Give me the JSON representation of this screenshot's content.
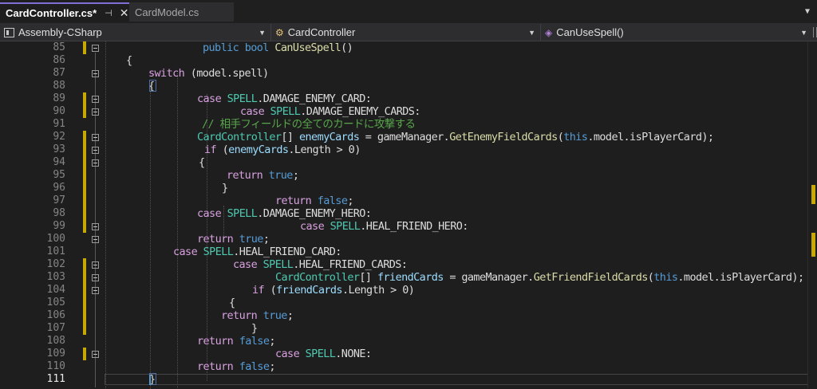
{
  "tabs": [
    {
      "label": "CardController.cs*",
      "active": true
    },
    {
      "label": "CardModel.cs",
      "active": false
    }
  ],
  "icons": {
    "pin": "pin-icon",
    "close": "close-icon",
    "overflow": "chevron-down-icon",
    "project": "csharp-project-icon",
    "class": "class-icon",
    "method": "method-icon"
  },
  "navbar": {
    "project": "Assembly-CSharp",
    "type": "CardController",
    "member": "CanUseSpell()"
  },
  "colors": {
    "keyword": "#569cd6",
    "type": "#4ec9b0",
    "text": "#dcdcdc",
    "comment": "#57a64a",
    "variable": "#9cdcfe",
    "method": "#dcdcaa",
    "change_marker": "#c9a800"
  },
  "editor": {
    "lines": [
      {
        "num": "85",
        "tokens": [
          [
            "kw",
            "public "
          ],
          [
            "kw",
            "bool "
          ],
          [
            "mt",
            "CanUseSpell"
          ],
          [
            "tx",
            "()"
          ]
        ]
      },
      {
        "num": "86",
        "tokens": [
          [
            "tx",
            "{"
          ]
        ]
      },
      {
        "num": "87",
        "tokens": [
          [
            "ctl",
            "switch"
          ],
          [
            "tx",
            " (model.spell)"
          ]
        ]
      },
      {
        "num": "88",
        "tokens": [
          [
            "tx",
            "{"
          ]
        ]
      },
      {
        "num": "89",
        "tokens": [
          [
            "ctl",
            "case "
          ],
          [
            "tp",
            "SPELL"
          ],
          [
            "tx",
            ".DAMAGE_ENEMY_CARD:"
          ]
        ]
      },
      {
        "num": "90",
        "tokens": [
          [
            "ctl",
            "case "
          ],
          [
            "tp",
            "SPELL"
          ],
          [
            "tx",
            ".DAMAGE_ENEMY_CARDS:"
          ]
        ]
      },
      {
        "num": "91",
        "tokens": [
          [
            "cm",
            "// 相手フィールドの全てのカードに攻撃する"
          ]
        ]
      },
      {
        "num": "92",
        "tokens": [
          [
            "tp",
            "CardController"
          ],
          [
            "tx",
            "[] "
          ],
          [
            "var",
            "enemyCards"
          ],
          [
            "tx",
            " = gameManager."
          ],
          [
            "mt",
            "GetEnemyFieldCards"
          ],
          [
            "tx",
            "("
          ],
          [
            "kw",
            "this"
          ],
          [
            "tx",
            ".model.isPlayerCard);"
          ]
        ]
      },
      {
        "num": "93",
        "tokens": [
          [
            "ctl",
            "if"
          ],
          [
            "tx",
            " ("
          ],
          [
            "var",
            "enemyCards"
          ],
          [
            "tx",
            ".Length > 0)"
          ]
        ]
      },
      {
        "num": "94",
        "tokens": [
          [
            "tx",
            "{"
          ]
        ]
      },
      {
        "num": "95",
        "tokens": [
          [
            "ctl",
            "return "
          ],
          [
            "kw",
            "true"
          ],
          [
            "tx",
            ";"
          ]
        ]
      },
      {
        "num": "96",
        "tokens": [
          [
            "tx",
            "}"
          ]
        ]
      },
      {
        "num": "97",
        "tokens": [
          [
            "ctl",
            "return "
          ],
          [
            "kw",
            "false"
          ],
          [
            "tx",
            ";"
          ]
        ]
      },
      {
        "num": "98",
        "tokens": [
          [
            "ctl",
            "case "
          ],
          [
            "tp",
            "SPELL"
          ],
          [
            "tx",
            ".DAMAGE_ENEMY_HERO:"
          ]
        ]
      },
      {
        "num": "99",
        "tokens": [
          [
            "ctl",
            "case "
          ],
          [
            "tp",
            "SPELL"
          ],
          [
            "tx",
            ".HEAL_FRIEND_HERO:"
          ]
        ]
      },
      {
        "num": "100",
        "tokens": [
          [
            "ctl",
            "return "
          ],
          [
            "kw",
            "true"
          ],
          [
            "tx",
            ";"
          ]
        ]
      },
      {
        "num": "101",
        "tokens": [
          [
            "ctl",
            "case "
          ],
          [
            "tp",
            "SPELL"
          ],
          [
            "tx",
            ".HEAL_FRIEND_CARD:"
          ]
        ]
      },
      {
        "num": "102",
        "tokens": [
          [
            "ctl",
            "case "
          ],
          [
            "tp",
            "SPELL"
          ],
          [
            "tx",
            ".HEAL_FRIEND_CARDS:"
          ]
        ]
      },
      {
        "num": "103",
        "tokens": [
          [
            "tp",
            "CardController"
          ],
          [
            "tx",
            "[] "
          ],
          [
            "var",
            "friendCards"
          ],
          [
            "tx",
            " = gameManager."
          ],
          [
            "mt",
            "GetFriendFieldCards"
          ],
          [
            "tx",
            "("
          ],
          [
            "kw",
            "this"
          ],
          [
            "tx",
            ".model.isPlayerCard);"
          ]
        ]
      },
      {
        "num": "104",
        "tokens": [
          [
            "ctl",
            "if"
          ],
          [
            "tx",
            " ("
          ],
          [
            "var",
            "friendCards"
          ],
          [
            "tx",
            ".Length > 0)"
          ]
        ]
      },
      {
        "num": "105",
        "tokens": [
          [
            "tx",
            "{"
          ]
        ]
      },
      {
        "num": "106",
        "tokens": [
          [
            "ctl",
            "return "
          ],
          [
            "kw",
            "true"
          ],
          [
            "tx",
            ";"
          ]
        ]
      },
      {
        "num": "107",
        "tokens": [
          [
            "tx",
            "}"
          ]
        ]
      },
      {
        "num": "108",
        "tokens": [
          [
            "ctl",
            "return "
          ],
          [
            "kw",
            "false"
          ],
          [
            "tx",
            ";"
          ]
        ]
      },
      {
        "num": "109",
        "tokens": [
          [
            "ctl",
            "case "
          ],
          [
            "tp",
            "SPELL"
          ],
          [
            "tx",
            ".NONE:"
          ]
        ]
      },
      {
        "num": "110",
        "tokens": [
          [
            "ctl",
            "return "
          ],
          [
            "kw",
            "false"
          ],
          [
            "tx",
            ";"
          ]
        ]
      },
      {
        "num": "111",
        "tokens": [
          [
            "tx",
            "}"
          ]
        ]
      }
    ]
  }
}
